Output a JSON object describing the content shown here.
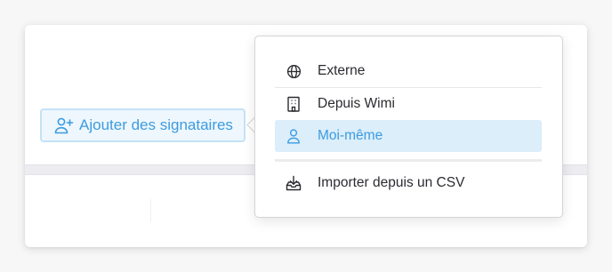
{
  "add_button": {
    "label": "Ajouter des signataires",
    "icon": "user-plus-icon",
    "color": "#3d9be0"
  },
  "menu": {
    "items": [
      {
        "label": "Externe",
        "icon": "globe-icon",
        "active": false
      },
      {
        "label": "Depuis Wimi",
        "icon": "building-icon",
        "active": false
      },
      {
        "label": "Moi-même",
        "icon": "user-icon",
        "active": true
      },
      {
        "label": "Importer depuis un CSV",
        "icon": "download-tray-icon",
        "active": false
      }
    ],
    "active_bg": "#dbeefa",
    "active_color": "#3d9be0"
  }
}
